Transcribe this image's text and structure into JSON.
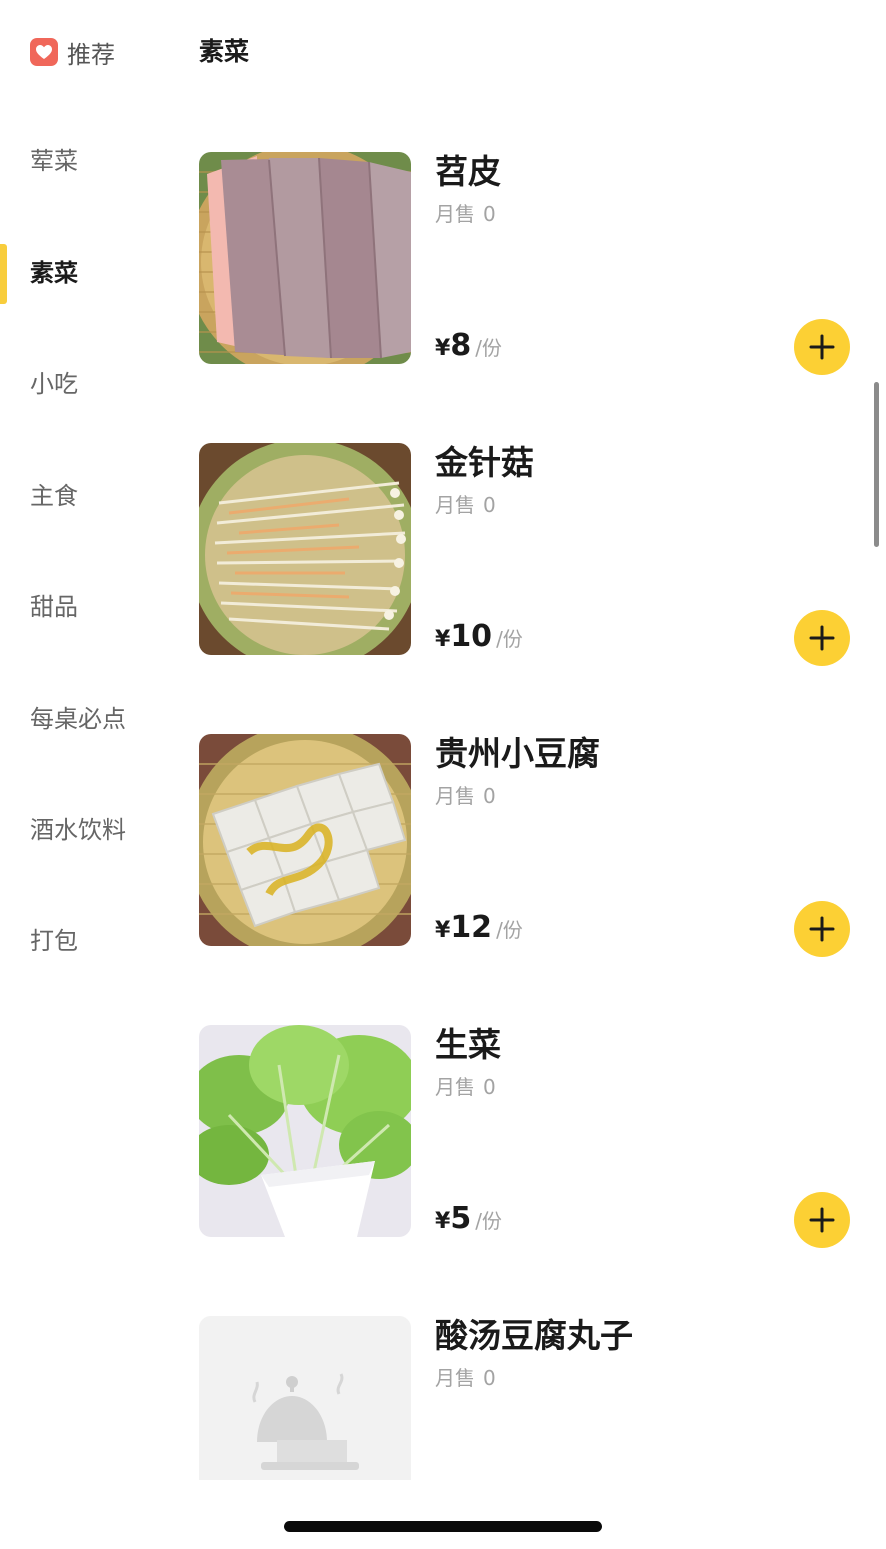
{
  "sidebar": {
    "recommend_label": "推荐",
    "categories": [
      {
        "label": "荤菜"
      },
      {
        "label": "素菜"
      },
      {
        "label": "小吃"
      },
      {
        "label": "主食"
      },
      {
        "label": "甜品"
      },
      {
        "label": "每桌必点"
      },
      {
        "label": "酒水饮料"
      },
      {
        "label": "打包"
      }
    ],
    "active_index": 1
  },
  "main": {
    "section_title": "素菜",
    "sales_label": "月售",
    "currency": "¥",
    "unit": "/份",
    "dishes": [
      {
        "name": "苕皮",
        "sales": "0",
        "price": "8",
        "image": "sweet-potato-sheet-photo"
      },
      {
        "name": "金针菇",
        "sales": "0",
        "price": "10",
        "image": "enoki-mushroom-photo"
      },
      {
        "name": "贵州小豆腐",
        "sales": "0",
        "price": "12",
        "image": "guizhou-tofu-photo"
      },
      {
        "name": "生菜",
        "sales": "0",
        "price": "5",
        "image": "lettuce-photo"
      },
      {
        "name": "酸汤豆腐丸子",
        "sales": "0",
        "image": "placeholder-cloche-icon"
      }
    ]
  },
  "colors": {
    "accent": "#f8cd3c",
    "add_button": "#fcd034",
    "heart_badge": "#f0675a",
    "muted_text": "#a3a3a3"
  }
}
